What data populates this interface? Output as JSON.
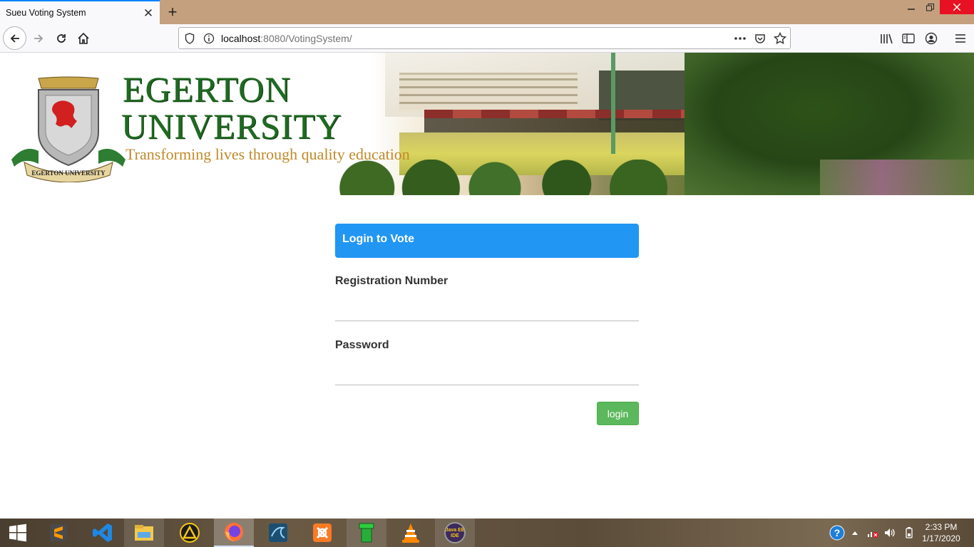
{
  "browser": {
    "tab_title": "Sueu Voting System",
    "url_host": "localhost",
    "url_rest": ":8080/VotingSystem/"
  },
  "header": {
    "logo_line1": "EGERTON",
    "logo_line2": "UNIVERSITY",
    "tagline": "Transforming lives through quality education",
    "crest_text": "EGERTON UNIVERSITY"
  },
  "login": {
    "title": "Login to Vote",
    "reg_label": "Registration Number",
    "reg_value": "",
    "password_label": "Password",
    "password_value": "",
    "button_label": "login"
  },
  "colors": {
    "header_blue": "#2196f3",
    "button_green": "#5cb85c",
    "logo_green": "#1f6a21",
    "tagline_gold": "#c08a2a"
  },
  "taskbar": {
    "apps": [
      "sublime-text",
      "vscode",
      "file-explorer",
      "arch-app",
      "firefox",
      "mysql-workbench",
      "xampp",
      "green-pipe-app",
      "vlc",
      "java-ee-ide"
    ],
    "java_label": "Java EE IDE",
    "time": "2:33 PM",
    "date": "1/17/2020"
  }
}
